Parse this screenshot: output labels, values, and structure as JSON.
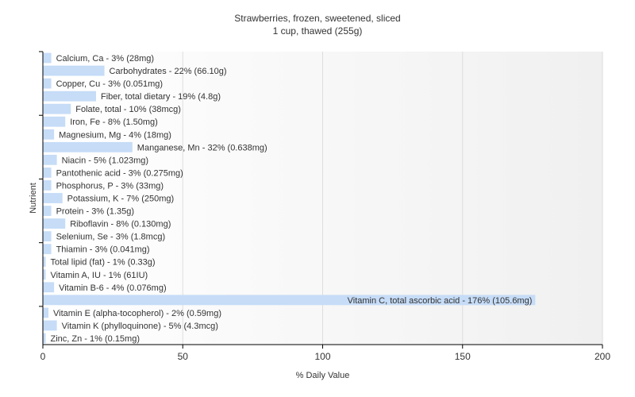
{
  "chart_data": {
    "type": "bar",
    "orientation": "horizontal",
    "title": "Strawberries, frozen, sweetened, sliced",
    "subtitle": "1 cup, thawed (255g)",
    "xlabel": "% Daily Value",
    "ylabel": "Nutrient",
    "xlim": [
      0,
      200
    ],
    "x_ticks": [
      "0",
      "50",
      "100",
      "150",
      "200"
    ],
    "grid": "vertical",
    "colors": {
      "bar": "#c6dcf7",
      "grid": "#dddddd",
      "plot_bg_start": "#ffffff",
      "plot_bg_end": "#f0f0f0",
      "axis": "#000000",
      "text": "#333333"
    },
    "categories": [
      "Calcium, Ca",
      "Carbohydrates",
      "Copper, Cu",
      "Fiber, total dietary",
      "Folate, total",
      "Iron, Fe",
      "Magnesium, Mg",
      "Manganese, Mn",
      "Niacin",
      "Pantothenic acid",
      "Phosphorus, P",
      "Potassium, K",
      "Protein",
      "Riboflavin",
      "Selenium, Se",
      "Thiamin",
      "Total lipid (fat)",
      "Vitamin A, IU",
      "Vitamin B-6",
      "Vitamin C, total ascorbic acid",
      "Vitamin E (alpha-tocopherol)",
      "Vitamin K (phylloquinone)",
      "Zinc, Zn"
    ],
    "values": [
      3,
      22,
      3,
      19,
      10,
      8,
      4,
      32,
      5,
      3,
      3,
      7,
      3,
      8,
      3,
      3,
      1,
      1,
      4,
      176,
      2,
      5,
      1
    ],
    "labels": [
      "Calcium, Ca - 3% (28mg)",
      "Carbohydrates - 22% (66.10g)",
      "Copper, Cu - 3% (0.051mg)",
      "Fiber, total dietary - 19% (4.8g)",
      "Folate, total - 10% (38mcg)",
      "Iron, Fe - 8% (1.50mg)",
      "Magnesium, Mg - 4% (18mg)",
      "Manganese, Mn - 32% (0.638mg)",
      "Niacin - 5% (1.023mg)",
      "Pantothenic acid - 3% (0.275mg)",
      "Phosphorus, P - 3% (33mg)",
      "Potassium, K - 7% (250mg)",
      "Protein - 3% (1.35g)",
      "Riboflavin - 8% (0.130mg)",
      "Selenium, Se - 3% (1.8mcg)",
      "Thiamin - 3% (0.041mg)",
      "Total lipid (fat) - 1% (0.33g)",
      "Vitamin A, IU - 1% (61IU)",
      "Vitamin B-6 - 4% (0.076mg)",
      "Vitamin C, total ascorbic acid - 176% (105.6mg)",
      "Vitamin E (alpha-tocopherol) - 2% (0.59mg)",
      "Vitamin K (phylloquinone) - 5% (4.3mcg)",
      "Zinc, Zn - 1% (0.15mg)"
    ]
  }
}
